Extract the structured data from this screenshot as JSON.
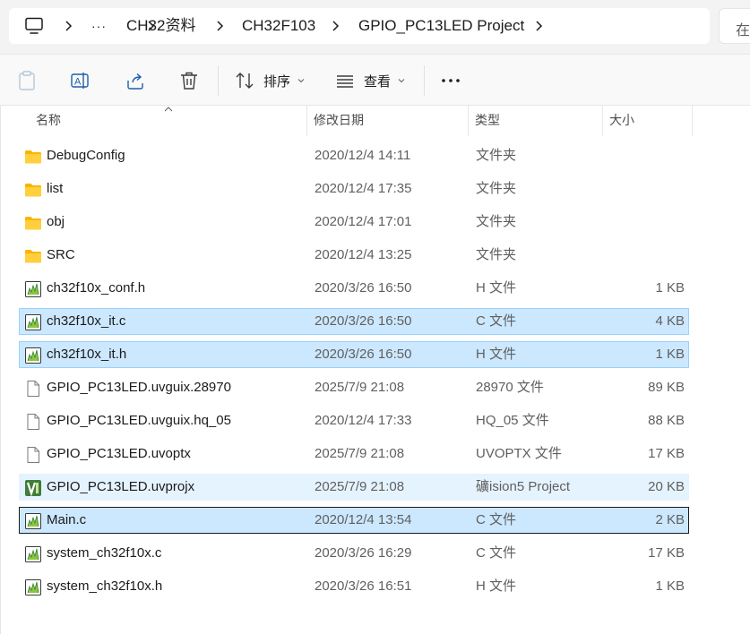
{
  "address": {
    "breadcrumbs": [
      "CH32资料",
      "CH32F103",
      "GPIO_PC13LED Project"
    ],
    "overflow": "···",
    "search_placeholder": "在"
  },
  "toolbar": {
    "sort_label": "排序",
    "view_label": "查看",
    "more_label": "···"
  },
  "columns": {
    "name": "名称",
    "modified": "修改日期",
    "type": "类型",
    "size": "大小"
  },
  "files": [
    {
      "name": "DebugConfig",
      "modified": "2020/12/4 14:11",
      "type": "文件夹",
      "size": "",
      "icon": "folder-icon",
      "state": "normal"
    },
    {
      "name": "list",
      "modified": "2020/12/4 17:35",
      "type": "文件夹",
      "size": "",
      "icon": "folder-icon",
      "state": "normal"
    },
    {
      "name": "obj",
      "modified": "2020/12/4 17:01",
      "type": "文件夹",
      "size": "",
      "icon": "folder-icon",
      "state": "normal"
    },
    {
      "name": "SRC",
      "modified": "2020/12/4 13:25",
      "type": "文件夹",
      "size": "",
      "icon": "folder-icon",
      "state": "normal"
    },
    {
      "name": "ch32f10x_conf.h",
      "modified": "2020/3/26 16:50",
      "type": "H 文件",
      "size": "1 KB",
      "icon": "source-file-icon",
      "state": "normal"
    },
    {
      "name": "ch32f10x_it.c",
      "modified": "2020/3/26 16:50",
      "type": "C 文件",
      "size": "4 KB",
      "icon": "source-file-icon",
      "state": "selected"
    },
    {
      "name": "ch32f10x_it.h",
      "modified": "2020/3/26 16:50",
      "type": "H 文件",
      "size": "1 KB",
      "icon": "source-file-icon",
      "state": "selected"
    },
    {
      "name": "GPIO_PC13LED.uvguix.28970",
      "modified": "2025/7/9 21:08",
      "type": "28970 文件",
      "size": "89 KB",
      "icon": "blank-file-icon",
      "state": "normal"
    },
    {
      "name": "GPIO_PC13LED.uvguix.hq_05",
      "modified": "2020/12/4 17:33",
      "type": "HQ_05 文件",
      "size": "88 KB",
      "icon": "blank-file-icon",
      "state": "normal"
    },
    {
      "name": "GPIO_PC13LED.uvoptx",
      "modified": "2025/7/9 21:08",
      "type": "UVOPTX 文件",
      "size": "17 KB",
      "icon": "blank-file-icon",
      "state": "normal"
    },
    {
      "name": "GPIO_PC13LED.uvprojx",
      "modified": "2025/7/9 21:08",
      "type": "礦ision5 Project",
      "size": "20 KB",
      "icon": "keil-project-icon",
      "state": "hover"
    },
    {
      "name": "Main.c",
      "modified": "2020/12/4 13:54",
      "type": "C 文件",
      "size": "2 KB",
      "icon": "source-file-icon",
      "state": "focused"
    },
    {
      "name": "system_ch32f10x.c",
      "modified": "2020/3/26 16:29",
      "type": "C 文件",
      "size": "17 KB",
      "icon": "source-file-icon",
      "state": "normal"
    },
    {
      "name": "system_ch32f10x.h",
      "modified": "2020/3/26 16:51",
      "type": "H 文件",
      "size": "1 KB",
      "icon": "source-file-icon",
      "state": "normal"
    }
  ]
}
